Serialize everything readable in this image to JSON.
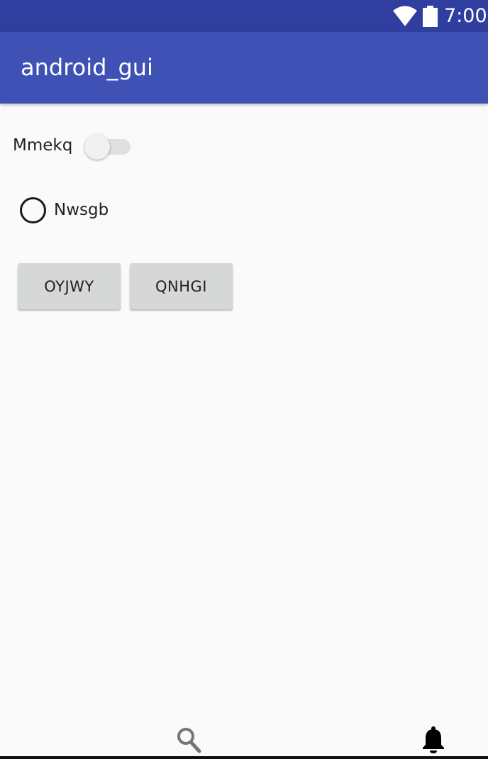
{
  "status_bar": {
    "time": "7:00",
    "icons": [
      "wifi-icon",
      "battery-icon"
    ]
  },
  "app_bar": {
    "title": "android_gui"
  },
  "controls": {
    "switch": {
      "label": "Mmekq",
      "checked": false
    },
    "radio": {
      "label": "Nwsgb",
      "checked": false
    },
    "buttons": [
      {
        "label": "OYJWY"
      },
      {
        "label": "QNHGI"
      }
    ]
  },
  "bottom_nav": {
    "icons": [
      "search-icon",
      "bell-icon"
    ]
  },
  "colors": {
    "status_bar": "#303f9f",
    "app_bar": "#3f51b5",
    "background": "#fafafa",
    "button": "#d6d7d7"
  }
}
